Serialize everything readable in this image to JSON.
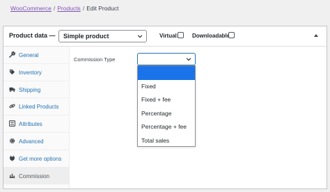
{
  "breadcrumb": {
    "root": "WooCommerce",
    "section": "Products",
    "current": "Edit Product",
    "separator": "/"
  },
  "product_data": {
    "title": "Product data —",
    "type_select": {
      "value": "Simple product"
    },
    "virtual_label": "Virtual:",
    "virtual_checked": false,
    "downloadable_label": "Downloadable:",
    "downloadable_checked": false
  },
  "tabs": [
    {
      "label": "General",
      "icon": "wrench-icon"
    },
    {
      "label": "Inventory",
      "icon": "tag-icon"
    },
    {
      "label": "Shipping",
      "icon": "truck-icon"
    },
    {
      "label": "Linked Products",
      "icon": "link-icon"
    },
    {
      "label": "Attributes",
      "icon": "list-icon"
    },
    {
      "label": "Advanced",
      "icon": "gear-icon"
    },
    {
      "label": "Get more options",
      "icon": "plug-icon"
    },
    {
      "label": "Commission",
      "icon": "commission-icon",
      "active": true
    }
  ],
  "commission": {
    "label": "Commission Type",
    "selected": "",
    "options": [
      "",
      "Fixed",
      "Fixed + fee",
      "Percentage",
      "Percentage + fee",
      "Total sales"
    ]
  },
  "colors": {
    "link": "#7f54b3",
    "tab_text": "#2271b1",
    "highlight": "#1a73e8",
    "focus_border": "#2271b1"
  }
}
